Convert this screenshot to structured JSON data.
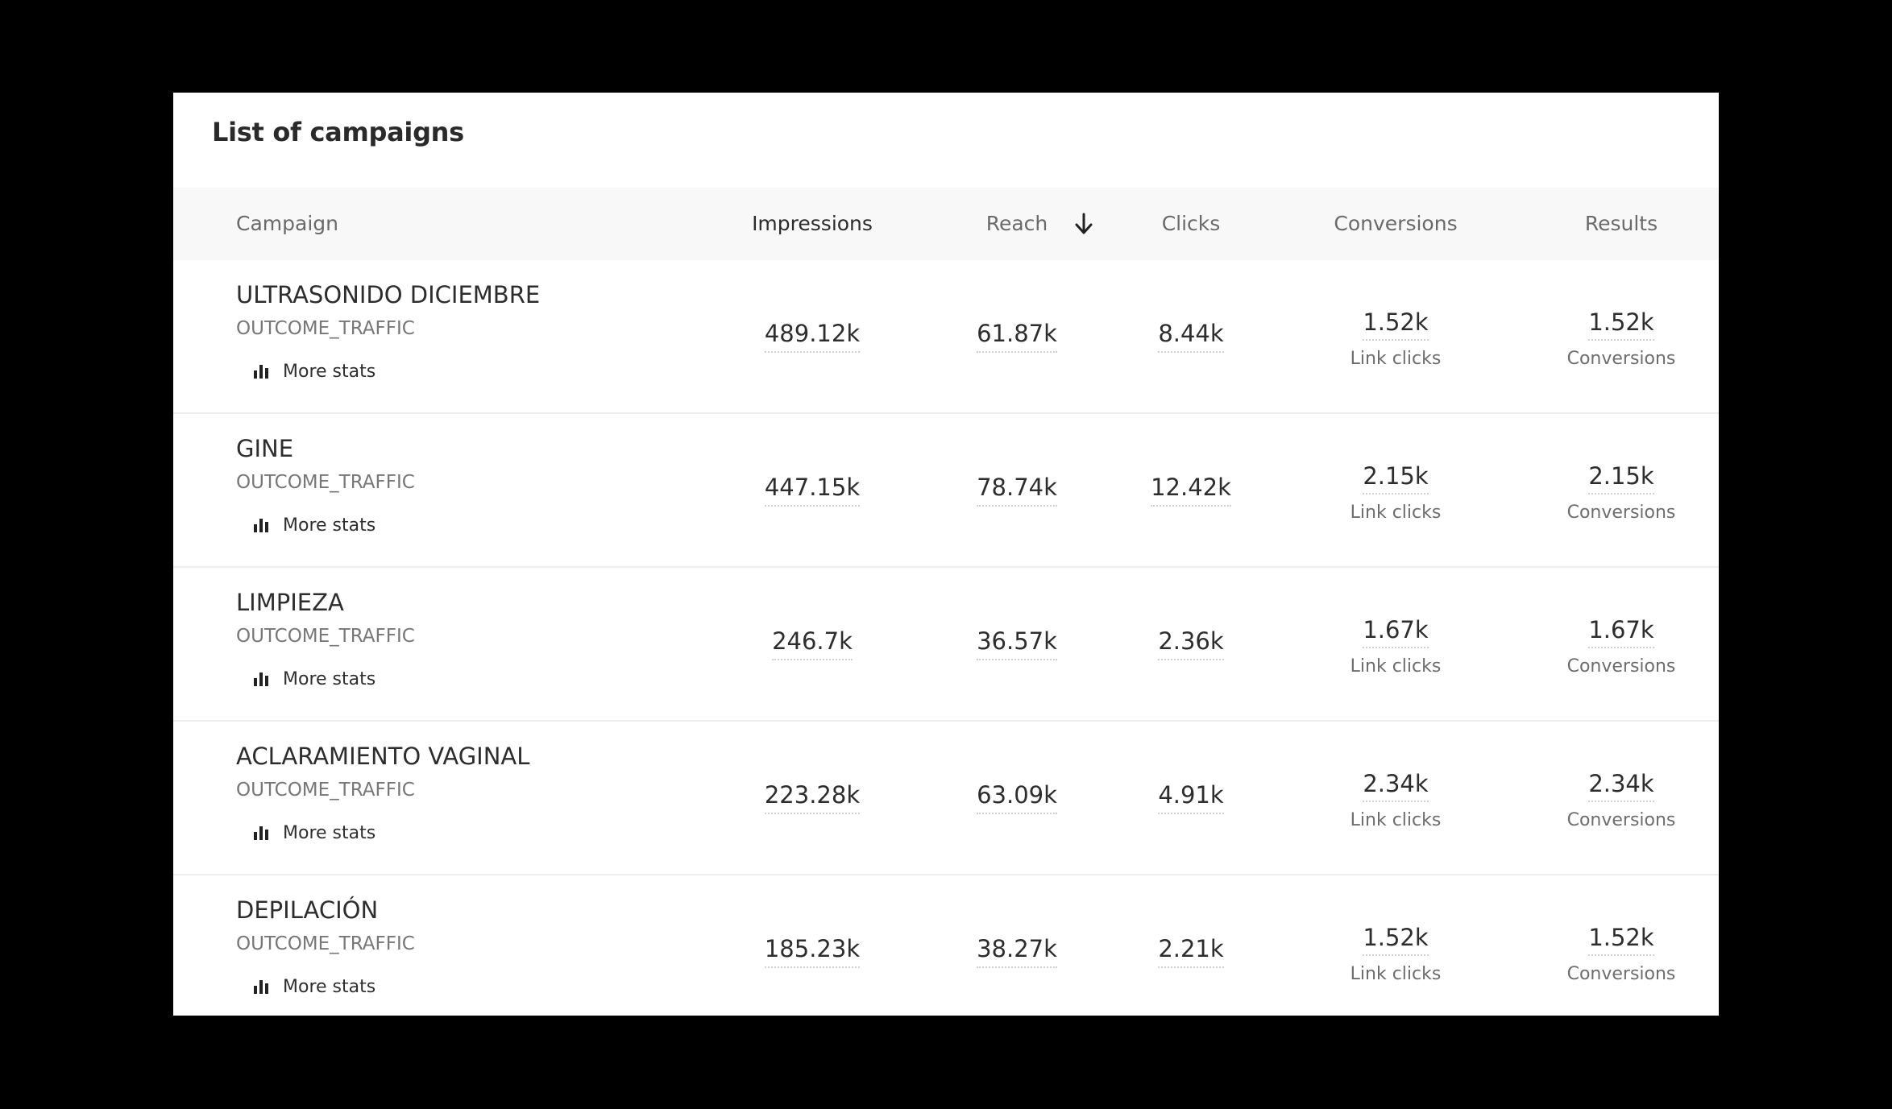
{
  "title": "List of campaigns",
  "columns": {
    "campaign": "Campaign",
    "impressions": "Impressions",
    "reach": "Reach",
    "clicks": "Clicks",
    "conversions": "Conversions",
    "results": "Results"
  },
  "sort": {
    "column": "impressions",
    "direction": "desc",
    "icon": "arrow-down-icon"
  },
  "rows": [
    {
      "name": "ULTRASONIDO DICIEMBRE",
      "objective": "OUTCOME_TRAFFIC",
      "more_stats": "More stats",
      "impressions": "489.12k",
      "reach": "61.87k",
      "clicks": "8.44k",
      "conversions": {
        "value": "1.52k",
        "label": "Link clicks"
      },
      "results": {
        "value": "1.52k",
        "label": "Conversions"
      }
    },
    {
      "name": "GINE",
      "objective": "OUTCOME_TRAFFIC",
      "more_stats": "More stats",
      "impressions": "447.15k",
      "reach": "78.74k",
      "clicks": "12.42k",
      "conversions": {
        "value": "2.15k",
        "label": "Link clicks"
      },
      "results": {
        "value": "2.15k",
        "label": "Conversions"
      }
    },
    {
      "name": "LIMPIEZA",
      "objective": "OUTCOME_TRAFFIC",
      "more_stats": "More stats",
      "impressions": "246.7k",
      "reach": "36.57k",
      "clicks": "2.36k",
      "conversions": {
        "value": "1.67k",
        "label": "Link clicks"
      },
      "results": {
        "value": "1.67k",
        "label": "Conversions"
      }
    },
    {
      "name": "ACLARAMIENTO VAGINAL",
      "objective": "OUTCOME_TRAFFIC",
      "more_stats": "More stats",
      "impressions": "223.28k",
      "reach": "63.09k",
      "clicks": "4.91k",
      "conversions": {
        "value": "2.34k",
        "label": "Link clicks"
      },
      "results": {
        "value": "2.34k",
        "label": "Conversions"
      }
    },
    {
      "name": "DEPILACIÓN",
      "objective": "OUTCOME_TRAFFIC",
      "more_stats": "More stats",
      "impressions": "185.23k",
      "reach": "38.27k",
      "clicks": "2.21k",
      "conversions": {
        "value": "1.52k",
        "label": "Link clicks"
      },
      "results": {
        "value": "1.52k",
        "label": "Conversions"
      }
    }
  ]
}
